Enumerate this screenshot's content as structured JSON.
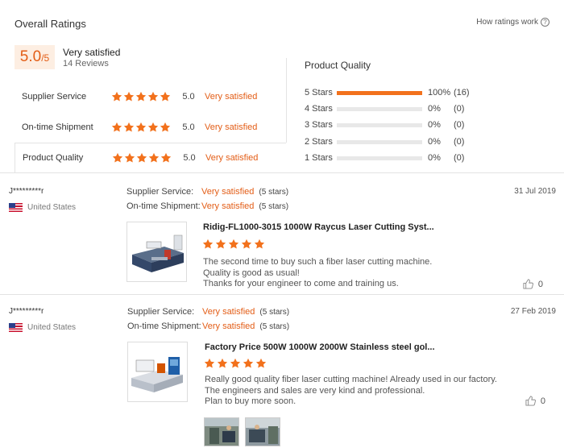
{
  "header": {
    "title": "Overall Ratings",
    "how_link": "How ratings work",
    "help_glyph": "?"
  },
  "overall": {
    "score": "5.0",
    "out_of": "/5",
    "label": "Very satisfied",
    "reviews": "14 Reviews"
  },
  "sub_ratings": [
    {
      "label": "Supplier Service",
      "score": "5.0",
      "text": "Very satisfied",
      "stars": 5
    },
    {
      "label": "On-time Shipment",
      "score": "5.0",
      "text": "Very satisfied",
      "stars": 5
    },
    {
      "label": "Product Quality",
      "score": "5.0",
      "text": "Very satisfied",
      "stars": 5
    }
  ],
  "product_quality": {
    "title": "Product Quality",
    "rows": [
      {
        "label": "5 Stars",
        "pct": "100%",
        "count": "(16)",
        "fraction": 1.0
      },
      {
        "label": "4 Stars",
        "pct": "0%",
        "count": "(0)",
        "fraction": 0
      },
      {
        "label": "3 Stars",
        "pct": "0%",
        "count": "(0)",
        "fraction": 0
      },
      {
        "label": "2 Stars",
        "pct": "0%",
        "count": "(0)",
        "fraction": 0
      },
      {
        "label": "1 Stars",
        "pct": "0%",
        "count": "(0)",
        "fraction": 0
      }
    ]
  },
  "reviews": [
    {
      "user": "J*********r",
      "country": "United States",
      "date": "31 Jul 2019",
      "supplier_key": "Supplier Service:",
      "supplier_val": "Very satisfied",
      "supplier_stars": "(5 stars)",
      "shipment_key": "On-time Shipment:",
      "shipment_val": "Very satisfied",
      "shipment_stars": "(5 stars)",
      "product_title": "Ridig-FL1000-3015 1000W Raycus Laser Cutting Syst...",
      "rating": 5,
      "text": [
        "The second time to buy such a fiber laser cutting machine.",
        "Quality is good as usual!",
        "Thanks for your engineer to come and training us."
      ],
      "likes": "0"
    },
    {
      "user": "J*********r",
      "country": "United States",
      "date": "27 Feb 2019",
      "supplier_key": "Supplier Service:",
      "supplier_val": "Very satisfied",
      "supplier_stars": "(5 stars)",
      "shipment_key": "On-time Shipment:",
      "shipment_val": "Very satisfied",
      "shipment_stars": "(5 stars)",
      "product_title": "Factory Price 500W 1000W 2000W Stainless steel gol...",
      "rating": 5,
      "text": [
        "Really good quality fiber laser cutting machine! Already used in our factory.",
        "The engineers and sales are very kind and professional.",
        "Plan to buy more soon."
      ],
      "likes": "0"
    }
  ],
  "colors": {
    "accent": "#e35d16",
    "star": "#f2711c",
    "bar": "#f2711c"
  }
}
